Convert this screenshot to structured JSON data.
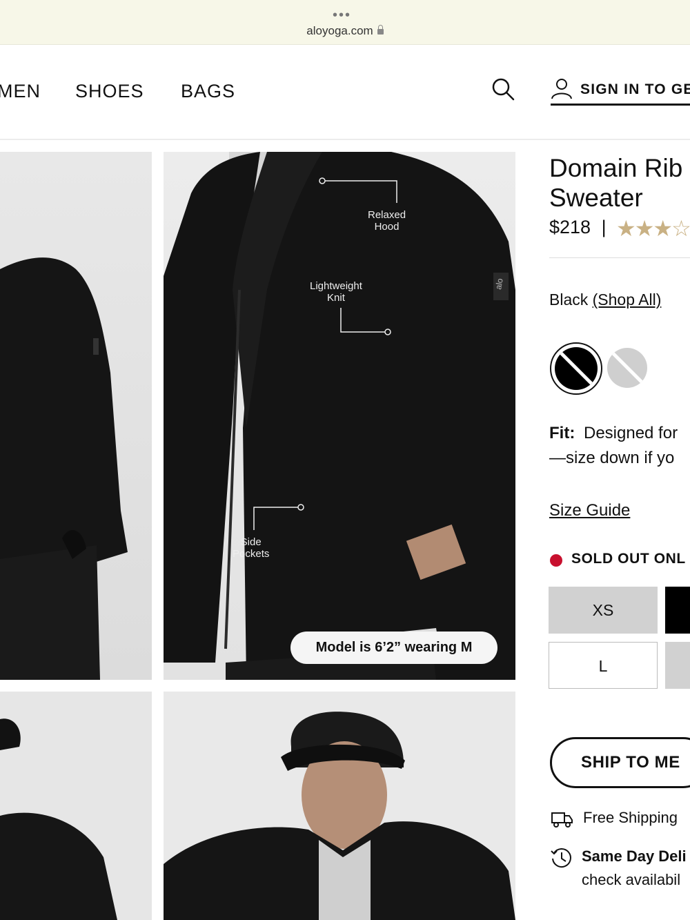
{
  "browser": {
    "url": "aloyoga.com",
    "dots": "•••"
  },
  "nav": {
    "men": "MEN",
    "shoes": "SHOES",
    "bags": "BAGS",
    "sign_in": "SIGN IN TO GE"
  },
  "gallery": {
    "callouts": {
      "relaxed_hood": [
        "Relaxed",
        "Hood"
      ],
      "lightweight_knit": [
        "Lightweight",
        "Knit"
      ],
      "side_pockets": [
        "Side",
        "Pockets"
      ]
    },
    "sleeve_logo": "alo",
    "model_info": "Model is 6’2” wearing M"
  },
  "product": {
    "title_line1": "Domain Rib",
    "title_line2": "Sweater",
    "price": "$218",
    "price_separator": "|",
    "stars": "★★★☆",
    "color_label": "Black",
    "color_link": "(Shop All)",
    "fit_label": "Fit:",
    "fit_text": "Designed for",
    "fit_text_line2": "—size down if yo",
    "size_guide": "Size Guide",
    "stock_status": "SOLD OUT ONL",
    "sizes": [
      "XS",
      "L"
    ],
    "ship_button": "SHIP TO ME",
    "free_shipping": "Free Shipping",
    "same_day": "Same Day Deli",
    "check_availability": "check availabil"
  },
  "colors": {
    "sold_out_dot": "#c8102e",
    "star": "#c9b184"
  }
}
